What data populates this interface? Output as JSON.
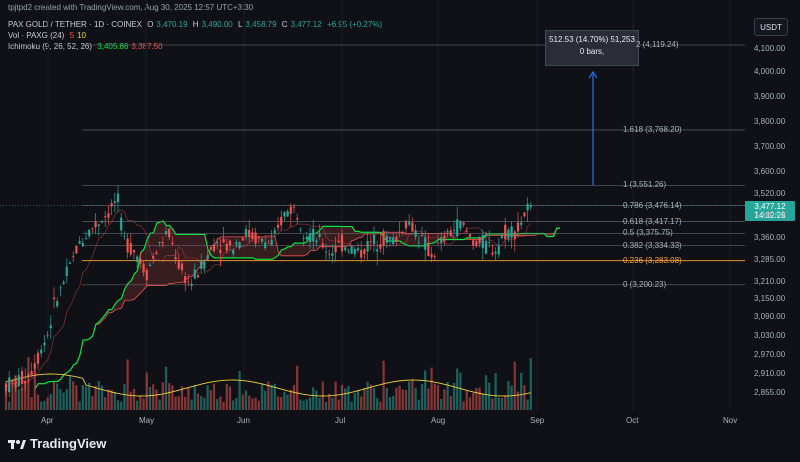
{
  "header": {
    "attribution": "tpjtpd2 created with TradingView.com, Aug 30, 2025 12:57 UTC+3:30",
    "symbol": "PAX GOLD / TETHER · 1D · COINEX",
    "o_label": "O",
    "o": "3,470.19",
    "h_label": "H",
    "h": "3,490.00",
    "l_label": "L",
    "l": "3,458.79",
    "c_label": "C",
    "c": "3,477.12",
    "change": "+6.95 (+0.27%)",
    "vol_label": "Vol · PAXG (24)",
    "vol_a": "5",
    "vol_b": "10",
    "ichimoku_label": "Ichimoku (9, 26, 52, 26)",
    "ichimoku_a": "3,405.86",
    "ichimoku_b": "3,387.50"
  },
  "currency": "USDT",
  "measure_tooltip": {
    "line1": "512.53 (14.70%) 51,253",
    "line2": "0 bars,"
  },
  "price_badge": {
    "price": "3,477.12",
    "countdown": "14:32:28"
  },
  "logo": "TradingView",
  "colors": {
    "up": "#26a69a",
    "down": "#ef5350",
    "green_line": "#00e640",
    "red_line": "#ef5350",
    "fib_orange": "#f7a12f",
    "fib_line": "#8a8f99",
    "arrow": "#2f6ff0",
    "volume_ma": "#f2d13b"
  },
  "chart_data": {
    "type": "candlestick",
    "x_ticks": [
      "Apr",
      "May",
      "Jun",
      "Jul",
      "Aug",
      "Sep",
      "Oct",
      "Nov"
    ],
    "y_ticks": [
      "4,100.00",
      "4,000.00",
      "3,900.00",
      "3,800.00",
      "3,700.00",
      "3,600.00",
      "3,520.00",
      "3,440.00",
      "3,360.00",
      "3,285.00",
      "3,210.00",
      "3,150.00",
      "3,090.00",
      "3,030.00",
      "2,970.00",
      "2,910.00",
      "2,855.00"
    ],
    "y_range": [
      2830,
      4150
    ],
    "fib_levels": [
      {
        "ratio": "0",
        "price": 3200.23,
        "label": "0 (3,200.23)"
      },
      {
        "ratio": "0.236",
        "price": 3283.08,
        "label": "0.236 (3,283.08)"
      },
      {
        "ratio": "0.382",
        "price": 3334.33,
        "label": "0.382 (3,334.33)"
      },
      {
        "ratio": "0.5",
        "price": 3375.75,
        "label": "0.5 (3,375.75)"
      },
      {
        "ratio": "0.618",
        "price": 3417.17,
        "label": "0.618 (3,417.17)"
      },
      {
        "ratio": "0.786",
        "price": 3476.14,
        "label": "0.786 (3,476.14)"
      },
      {
        "ratio": "1",
        "price": 3551.26,
        "label": "1 (3,551.26)"
      },
      {
        "ratio": "1.618",
        "price": 3768.2,
        "label": "1.618 (3,768.20)"
      },
      {
        "ratio": "2",
        "price": 4119.24,
        "label": "2 (4,119.24)"
      }
    ],
    "target_arrow": {
      "from": 3551.26,
      "to": 4000.0
    },
    "close_path": [
      [
        "Mar 20",
        2880
      ],
      [
        "Mar 25",
        2910
      ],
      [
        "Mar 28",
        2970
      ],
      [
        "Apr 1",
        3040
      ],
      [
        "Apr 3",
        3130
      ],
      [
        "Apr 7",
        3240
      ],
      [
        "Apr 10",
        3330
      ],
      [
        "Apr 14",
        3390
      ],
      [
        "Apr 17",
        3420
      ],
      [
        "Apr 21",
        3470
      ],
      [
        "Apr 22",
        3520
      ],
      [
        "Apr 24",
        3360
      ],
      [
        "Apr 28",
        3310
      ],
      [
        "May 1",
        3240
      ],
      [
        "May 5",
        3330
      ],
      [
        "May 8",
        3380
      ],
      [
        "May 12",
        3250
      ],
      [
        "May 15",
        3200
      ],
      [
        "May 20",
        3290
      ],
      [
        "May 23",
        3350
      ],
      [
        "May 28",
        3330
      ],
      [
        "Jun 2",
        3380
      ],
      [
        "Jun 6",
        3350
      ],
      [
        "Jun 10",
        3340
      ],
      [
        "Jun 13",
        3440
      ],
      [
        "Jun 16",
        3470
      ],
      [
        "Jun 20",
        3380
      ],
      [
        "Jun 24",
        3350
      ],
      [
        "Jun 27",
        3310
      ],
      [
        "Jul 1",
        3340
      ],
      [
        "Jul 7",
        3310
      ],
      [
        "Jul 10",
        3340
      ],
      [
        "Jul 14",
        3360
      ],
      [
        "Jul 18",
        3350
      ],
      [
        "Jul 22",
        3420
      ],
      [
        "Jul 25",
        3380
      ],
      [
        "Jul 30",
        3300
      ],
      [
        "Aug 4",
        3370
      ],
      [
        "Aug 8",
        3410
      ],
      [
        "Aug 12",
        3350
      ],
      [
        "Aug 15",
        3340
      ],
      [
        "Aug 19",
        3320
      ],
      [
        "Aug 22",
        3380
      ],
      [
        "Aug 26",
        3390
      ],
      [
        "Aug 28",
        3440
      ],
      [
        "Aug 30",
        3477.12
      ]
    ]
  }
}
